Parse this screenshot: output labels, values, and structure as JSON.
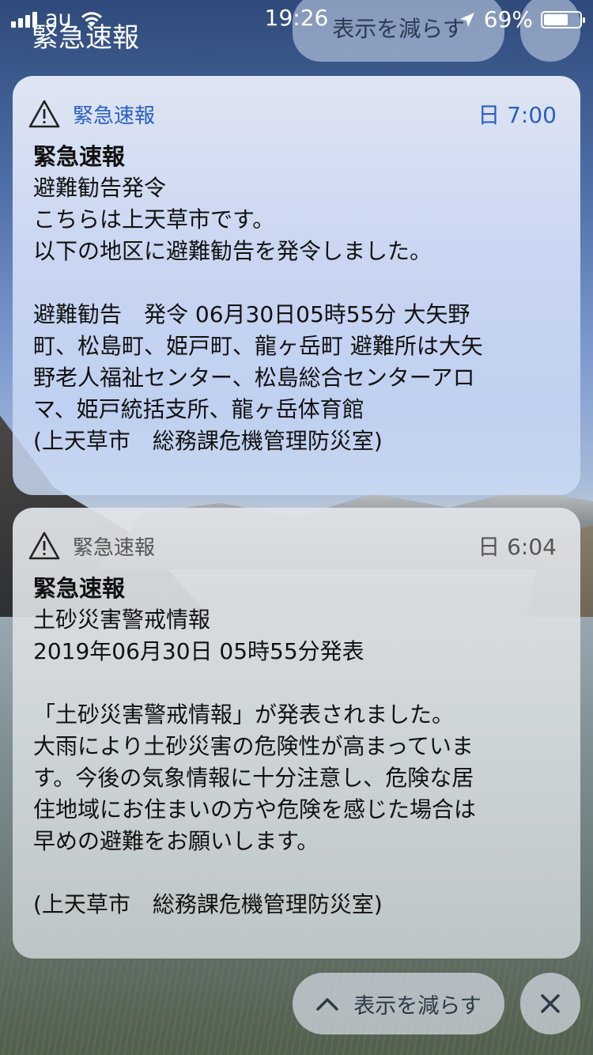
{
  "status_bar": {
    "carrier": "au",
    "time": "19:26",
    "battery": "69%",
    "battery_level": 0.69
  },
  "group": {
    "header_title": "緊急速報",
    "top_pill_label": "表示を減らす"
  },
  "notifications": [
    {
      "app_name": "緊急速報",
      "time": "日 7:00",
      "lines": [
        "緊急速報",
        "避難勧告発令",
        "こちらは上天草市です。",
        "以下の地区に避難勧告を発令しました。",
        "",
        "避難勧告　発令 06月30日05時55分 大矢野",
        "町、松島町、姫戸町、龍ヶ岳町 避難所は大矢",
        "野老人福祉センター、松島総合センターアロ",
        "マ、姫戸統括支所、龍ヶ岳体育館",
        "(上天草市　総務課危機管理防災室)"
      ]
    },
    {
      "app_name": "緊急速報",
      "time": "日 6:04",
      "lines": [
        "緊急速報",
        "土砂災害警戒情報",
        "2019年06月30日 05時55分発表",
        "",
        "「土砂災害警戒情報」が発表されました。",
        "大雨により土砂災害の危険性が高まっていま",
        "す。今後の気象情報に十分注意し、危険な居",
        "住地域にお住まいの方や危険を感じた場合は",
        "早めの避難をお願いします。",
        "",
        "(上天草市　総務課危機管理防災室)"
      ]
    }
  ],
  "controls": {
    "show_less_label": "表示を減らす"
  }
}
